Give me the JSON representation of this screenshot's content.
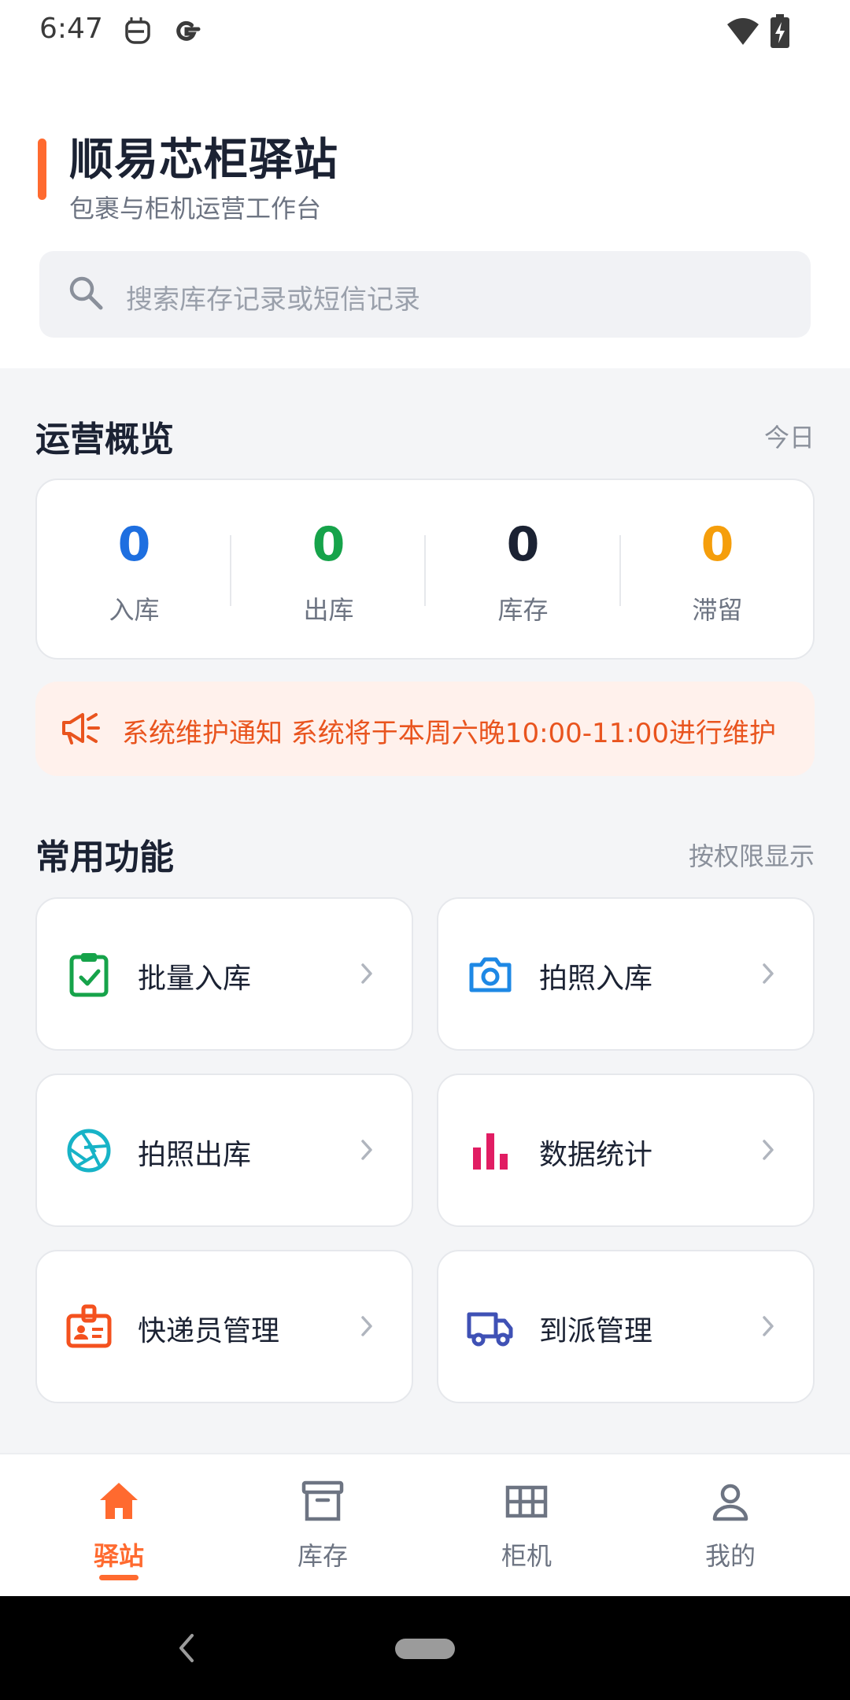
{
  "status_bar": {
    "time": "6:47"
  },
  "header": {
    "title": "顺易芯柜驿站",
    "subtitle": "包裹与柜机运营工作台"
  },
  "search": {
    "placeholder": "搜索库存记录或短信记录"
  },
  "overview": {
    "title": "运营概览",
    "period": "今日",
    "stats": [
      {
        "value": "0",
        "label": "入库",
        "color": "#1e6fe0"
      },
      {
        "value": "0",
        "label": "出库",
        "color": "#16a34a"
      },
      {
        "value": "0",
        "label": "库存",
        "color": "#1b2233"
      },
      {
        "value": "0",
        "label": "滞留",
        "color": "#f59e0b"
      }
    ]
  },
  "notice": {
    "icon": "megaphone-icon",
    "text": "系统维护通知 系统将于本周六晚10:00-11:00进行维护"
  },
  "features": {
    "title": "常用功能",
    "aside": "按权限显示",
    "items": [
      {
        "label": "批量入库",
        "icon": "clipboard-check-icon",
        "color": "#16a34a"
      },
      {
        "label": "拍照入库",
        "icon": "camera-icon",
        "color": "#1e88e5"
      },
      {
        "label": "拍照出库",
        "icon": "aperture-icon",
        "color": "#17b3c7"
      },
      {
        "label": "数据统计",
        "icon": "bar-chart-icon",
        "color": "#e11d63"
      },
      {
        "label": "快递员管理",
        "icon": "id-badge-icon",
        "color": "#f4511e"
      },
      {
        "label": "到派管理",
        "icon": "truck-icon",
        "color": "#3f51b5"
      }
    ]
  },
  "bottom_nav": {
    "items": [
      {
        "label": "驿站",
        "icon": "home-icon",
        "active": true
      },
      {
        "label": "库存",
        "icon": "archive-box-icon",
        "active": false
      },
      {
        "label": "柜机",
        "icon": "grid-icon",
        "active": false
      },
      {
        "label": "我的",
        "icon": "user-icon",
        "active": false
      }
    ],
    "accent_color": "#ff6a2f"
  }
}
